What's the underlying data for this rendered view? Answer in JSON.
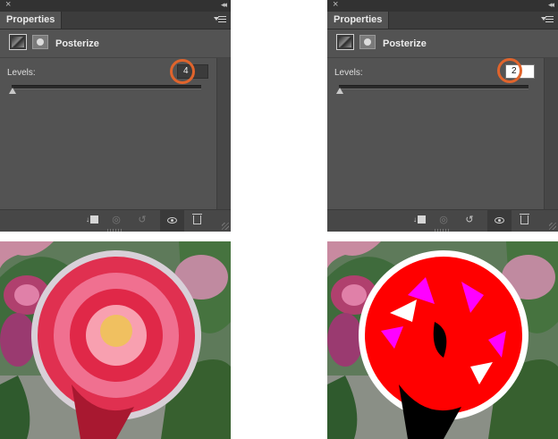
{
  "panels": [
    {
      "id": "before",
      "tab_label": "Properties",
      "close_glyph": "×",
      "collapse_glyph": "◂◂",
      "adjustment_title": "Posterize",
      "levels_label": "Levels:",
      "levels_value": "4",
      "slider_level_fraction": 0.0
    },
    {
      "id": "after",
      "tab_label": "Properties",
      "close_glyph": "×",
      "collapse_glyph": "◂◂",
      "adjustment_title": "Posterize",
      "levels_label": "Levels:",
      "levels_value": "2",
      "slider_level_fraction": 0.0
    }
  ],
  "footer_icons": [
    "clip-to-layer-icon",
    "view-previous-state-icon",
    "reset-icon",
    "toggle-visibility-icon",
    "delete-icon"
  ],
  "colors": {
    "panel_bg": "#535353",
    "titlebar_bg": "#323232",
    "highlight_ring": "#e0642c"
  }
}
